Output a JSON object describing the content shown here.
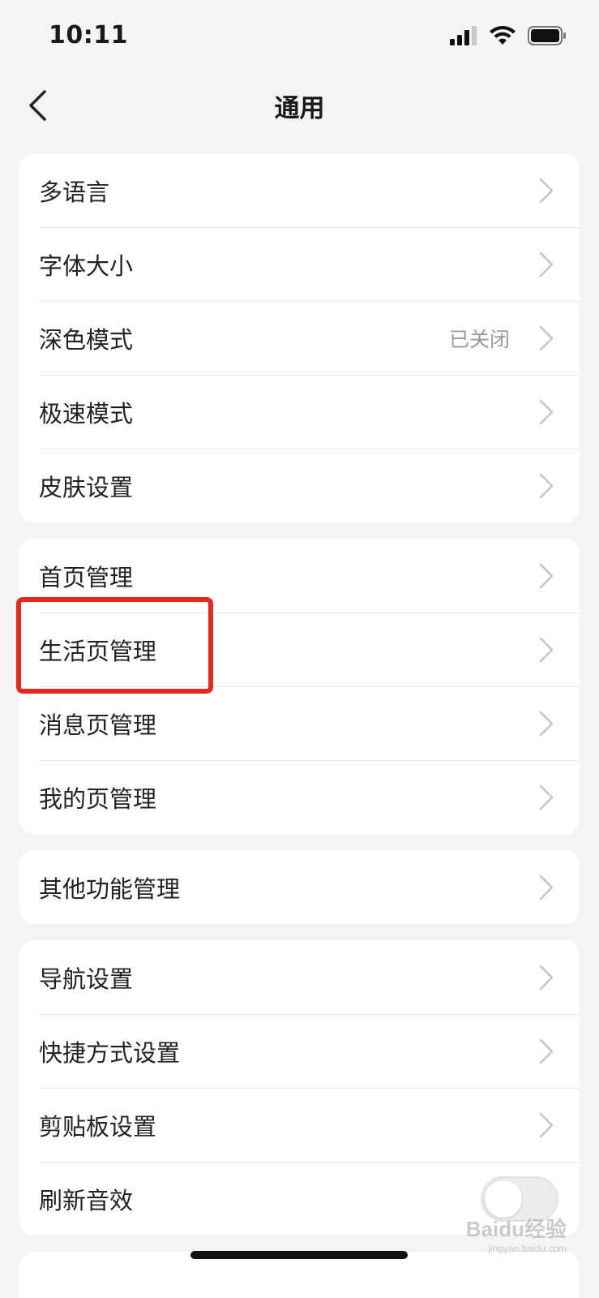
{
  "status_bar": {
    "time": "10:11"
  },
  "nav": {
    "title": "通用"
  },
  "groups": [
    {
      "rows": [
        {
          "label": "多语言"
        },
        {
          "label": "字体大小"
        },
        {
          "label": "深色模式",
          "value": "已关闭"
        },
        {
          "label": "极速模式"
        },
        {
          "label": "皮肤设置"
        }
      ]
    },
    {
      "rows": [
        {
          "label": "首页管理"
        },
        {
          "label": "生活页管理"
        },
        {
          "label": "消息页管理"
        },
        {
          "label": "我的页管理"
        }
      ]
    },
    {
      "rows": [
        {
          "label": "其他功能管理"
        }
      ]
    },
    {
      "rows": [
        {
          "label": "导航设置"
        },
        {
          "label": "快捷方式设置"
        },
        {
          "label": "剪贴板设置"
        },
        {
          "label": "刷新音效",
          "toggle": false
        }
      ]
    }
  ],
  "watermark": {
    "main": "Baidu经验",
    "sub": "jingyan.baidu.com"
  },
  "colors": {
    "background": "#f4f4f4",
    "card": "#ffffff",
    "highlight": "#e8281e",
    "secondary_text": "#9a9a9a"
  },
  "icons": [
    "back-chevron-icon",
    "cellular-signal-icon",
    "wifi-icon",
    "battery-icon",
    "chevron-right-icon"
  ]
}
